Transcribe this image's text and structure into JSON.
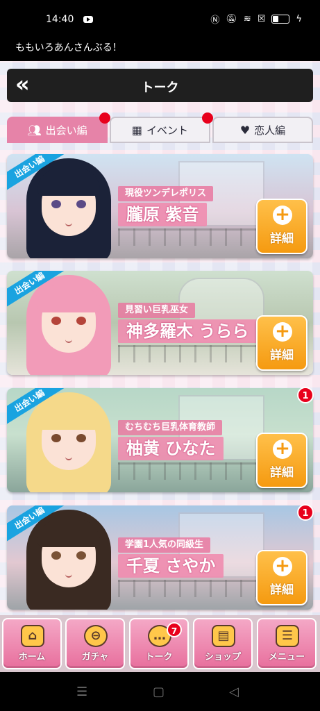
{
  "status_bar": {
    "time": "14:40",
    "app_title": "ももいろあんさんぶる！"
  },
  "header": {
    "back_icon": "double-chevron-left-icon",
    "back_glyph": "«",
    "title": "トーク"
  },
  "tabs": [
    {
      "label": "出会い編",
      "icon": "people-icon",
      "active": true,
      "has_dot": true
    },
    {
      "label": "イベント",
      "icon": "calendar-icon",
      "active": false,
      "has_dot": true
    },
    {
      "label": "恋人編",
      "icon": "heart-icon",
      "active": false,
      "has_dot": false
    }
  ],
  "cards": [
    {
      "ribbon": "出会い編",
      "subtitle": "現役ツンデレポリス",
      "name": "朧原 紫音",
      "detail": "詳細",
      "badge": ""
    },
    {
      "ribbon": "出会い編",
      "subtitle": "見習い巨乳巫女",
      "name": "神多羅木 うらら",
      "detail": "詳細",
      "badge": ""
    },
    {
      "ribbon": "出会い編",
      "subtitle": "むちむち巨乳体育教師",
      "name": "柚黄 ひなた",
      "detail": "詳細",
      "badge": "1"
    },
    {
      "ribbon": "出会い編",
      "subtitle": "学園1人気の同級生",
      "name": "千夏 さやか",
      "detail": "詳細",
      "badge": "1"
    }
  ],
  "bottom_nav": [
    {
      "label": "ホーム",
      "icon": "home-icon",
      "badge": ""
    },
    {
      "label": "ガチャ",
      "icon": "gacha-icon",
      "badge": ""
    },
    {
      "label": "トーク",
      "icon": "chat-bubble-icon",
      "badge": "7"
    },
    {
      "label": "ショップ",
      "icon": "shop-icon",
      "badge": ""
    },
    {
      "label": "メニュー",
      "icon": "menu-list-icon",
      "badge": ""
    }
  ],
  "colors": {
    "accent_pink": "#e683a8",
    "badge_red": "#e8001c",
    "detail_orange": "#f59a10",
    "ribbon_blue": "#1aa3e0"
  }
}
